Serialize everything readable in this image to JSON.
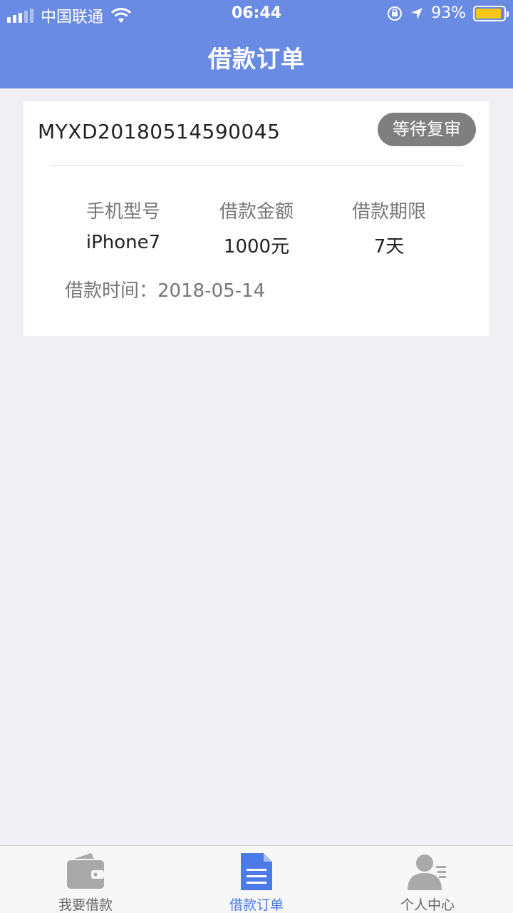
{
  "status_bar": {
    "carrier": "中国联通",
    "time": "06:44",
    "battery": "93%",
    "battery_level": 0.93
  },
  "header": {
    "title": "借款订单"
  },
  "order": {
    "order_no": "MYXD20180514590045",
    "status": "等待复审",
    "columns": [
      {
        "label": "手机型号",
        "value": "iPhone7"
      },
      {
        "label": "借款金额",
        "value": "1000元"
      },
      {
        "label": "借款期限",
        "value": "7天"
      }
    ],
    "loan_time_label": "借款时间：",
    "loan_time_value": "2018-05-14"
  },
  "tabbar": {
    "tabs": [
      {
        "label": "我要借款",
        "icon": "wallet-icon"
      },
      {
        "label": "借款订单",
        "icon": "document-icon",
        "active": true
      },
      {
        "label": "个人中心",
        "icon": "person-icon"
      }
    ]
  },
  "colors": {
    "header": "#6a8be4",
    "accent": "#4a7be6",
    "badge": "#7f7f7f",
    "background": "#efeff4"
  }
}
